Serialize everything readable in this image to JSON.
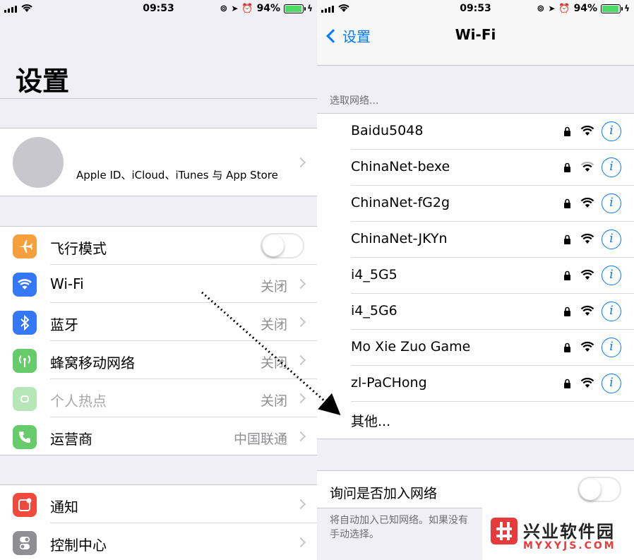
{
  "status": {
    "time": "09:53",
    "battery": "94%",
    "battery_level": 0.94
  },
  "left": {
    "title": "设置",
    "profile_label": "Apple ID、iCloud、iTunes 与 App Store",
    "rows": [
      {
        "label": "飞行模式",
        "value": "",
        "icon": "airplane-icon",
        "color": "#f6a03b"
      },
      {
        "label": "Wi-Fi",
        "value": "关闭",
        "icon": "wifi-icon",
        "color": "#3478f6"
      },
      {
        "label": "蓝牙",
        "value": "关闭",
        "icon": "bluetooth-icon",
        "color": "#3478f6"
      },
      {
        "label": "蜂窝移动网络",
        "value": "关闭",
        "icon": "cellular-icon",
        "color": "#66cc6b"
      },
      {
        "label": "个人热点",
        "value": "关闭",
        "icon": "hotspot-icon",
        "color": "#66cc6b"
      },
      {
        "label": "运营商",
        "value": "中国联通",
        "icon": "phone-icon",
        "color": "#66cc6b"
      },
      {
        "label": "通知",
        "value": "",
        "icon": "notification-icon",
        "color": "#f04a3c"
      },
      {
        "label": "控制中心",
        "value": "",
        "icon": "control-center-icon",
        "color": "#8e8e93"
      }
    ]
  },
  "right": {
    "back_label": "设置",
    "nav_title": "Wi-Fi",
    "section_caption": "选取网络...",
    "networks": [
      "Baidu5048",
      "ChinaNet-bexe",
      "ChinaNet-fG2g",
      "ChinaNet-JKYn",
      "i4_5G5",
      "i4_5G6",
      "Mo Xie Zuo Game",
      "zl-PaCHong"
    ],
    "other_label": "其他...",
    "ask_label": "询问是否加入网络",
    "footer_note": "将自动加入已知网络。如果没有\n手动选择。",
    "info_glyph": "i"
  },
  "watermark": {
    "title": "兴业软件园",
    "subtitle": "MYXYJS.COM"
  }
}
